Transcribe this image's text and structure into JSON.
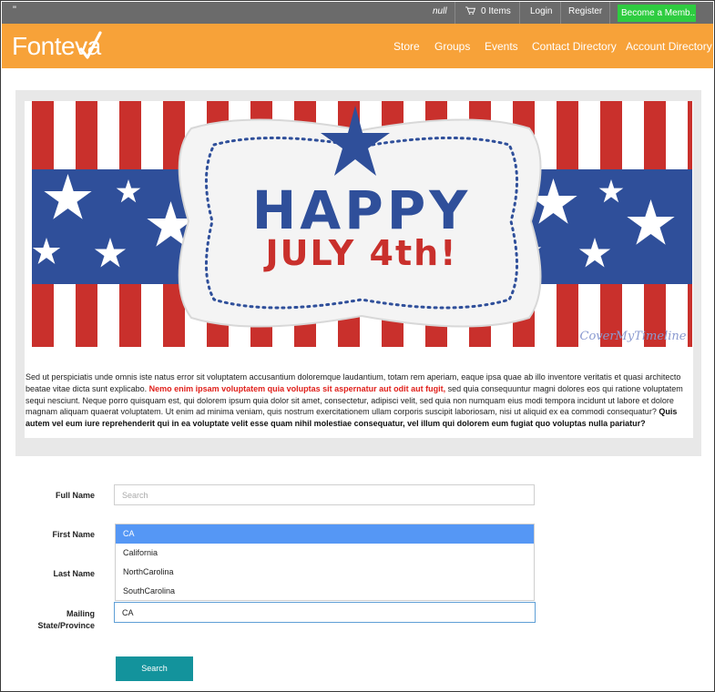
{
  "topbar": {
    "quote": "\"",
    "null_text": "null",
    "cart_label": "0 Items",
    "login": "Login",
    "register": "Register",
    "become_member": "Become a Memb..."
  },
  "nav": {
    "logo": "Fonteva",
    "links": [
      "Store",
      "Groups",
      "Events",
      "Contact Directory",
      "Account Directory"
    ]
  },
  "banner": {
    "line1": "HAPPY",
    "line2": "JULY 4th!",
    "watermark": "CoverMyTimeline"
  },
  "content": {
    "para_start": "Sed ut perspiciatis unde omnis iste natus error sit voluptatem accusantium doloremque laudantium, totam rem aperiam, eaque ipsa quae ab illo inventore veritatis et quasi architecto beatae vitae dicta sunt explicabo. ",
    "para_red": "Nemo enim ipsam voluptatem quia voluptas sit aspernatur aut odit aut fugit,",
    "para_mid": " sed quia consequuntur magni dolores eos qui ratione voluptatem sequi nesciunt. Neque porro quisquam est, qui dolorem ipsum quia dolor sit amet, consectetur, adipisci velit, sed quia non numquam eius modi tempora incidunt ut labore et dolore magnam aliquam quaerat voluptatem. Ut enim ad minima veniam, quis nostrum exercitationem ullam corporis suscipit laboriosam, nisi ut aliquid ex ea commodi consequatur? ",
    "para_bold": "Quis autem vel eum iure reprehenderit qui in ea voluptate velit esse quam nihil molestiae consequatur, vel illum qui dolorem eum fugiat quo voluptas nulla pariatur?"
  },
  "form": {
    "full_name_label": "Full Name",
    "full_name_placeholder": "Search",
    "first_name_label": "First Name",
    "last_name_label": "Last Name",
    "state_label": "Mailing State/Province",
    "state_value": "CA",
    "dropdown_options": [
      "CA",
      "California",
      "NorthCarolina",
      "SouthCarolina"
    ],
    "search_button": "Search"
  },
  "colors": {
    "nav_orange": "#f7a239",
    "become_green": "#2ecc40",
    "button_teal": "#13939c",
    "selected_blue": "#5597f5"
  }
}
